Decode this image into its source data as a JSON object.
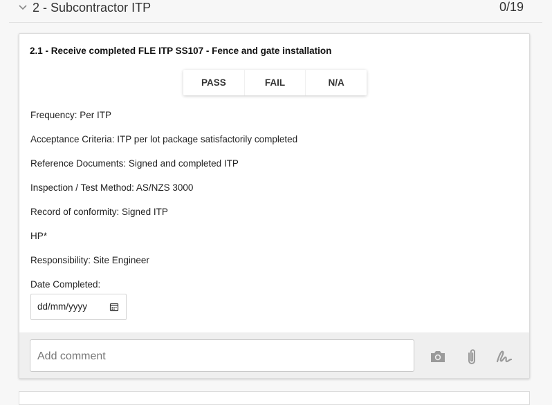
{
  "section": {
    "title": "2 - Subcontractor ITP",
    "count": "0/19"
  },
  "item": {
    "title": "2.1 - Receive completed FLE ITP SS107 - Fence and gate installation",
    "options": [
      "PASS",
      "FAIL",
      "N/A"
    ],
    "frequency": "Frequency: Per ITP",
    "acceptance": "Acceptance Criteria: ITP per lot package satisfactorily completed",
    "reference": "Reference Documents: Signed and completed ITP",
    "method": "Inspection / Test Method: AS/NZS 3000",
    "record": "Record of conformity: Signed ITP",
    "hold_point": "HP*",
    "responsibility": "Responsibility: Site Engineer",
    "date_label": "Date Completed:",
    "date_placeholder": "dd/mm/yyyy"
  },
  "comment": {
    "placeholder": "Add comment"
  },
  "icons": {
    "collapse": "chevron-down-icon",
    "calendar": "calendar-icon",
    "camera": "camera-icon",
    "attach": "paperclip-icon",
    "signature": "signature-icon"
  },
  "colors": {
    "icon_gray": "#9a9a9a",
    "footer_bg": "#efefef"
  }
}
